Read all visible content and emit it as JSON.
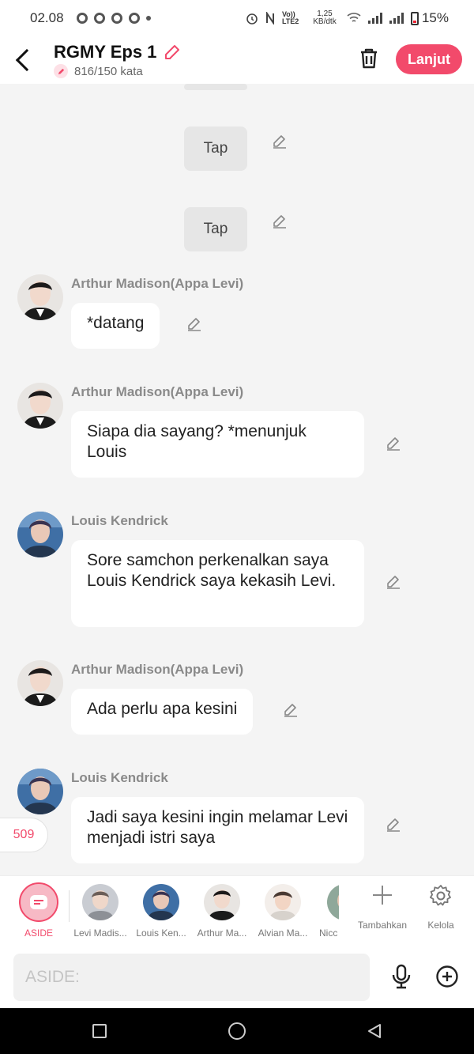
{
  "status_bar": {
    "time": "02.08",
    "net_label": "Vo)) LTE2",
    "speed": "1,25 KB/dtk",
    "battery": "15%"
  },
  "header": {
    "title": "RGMY Eps 1",
    "word_count": "816/150 kata",
    "next_button": "Lanjut"
  },
  "chat": {
    "tap_label": "Tap",
    "counter": "509",
    "messages": [
      {
        "sender": "Arthur Madison(Appa Levi)",
        "text": "*datang"
      },
      {
        "sender": "Arthur Madison(Appa Levi)",
        "text": "Siapa dia sayang? *menunjuk Louis"
      },
      {
        "sender": "Louis Kendrick",
        "text": "Sore samchon perkenalkan saya Louis Kendrick saya kekasih Levi."
      },
      {
        "sender": "Arthur Madison(Appa Levi)",
        "text": "Ada perlu apa kesini"
      },
      {
        "sender": "Louis Kendrick",
        "text": "Jadi saya kesini ingin melamar Levi menjadi istri saya"
      }
    ]
  },
  "character_bar": {
    "aside_label": "ASIDE",
    "characters": [
      "Levi Madis...",
      "Louis Ken...",
      "Arthur Ma...",
      "Alvian Ma...",
      "Nicc"
    ],
    "add_label": "Tambahkan",
    "manage_label": "Kelola"
  },
  "input": {
    "placeholder": "ASIDE:"
  },
  "colors": {
    "accent": "#f24a6b",
    "bubble": "#ffffff",
    "background": "#f4f4f4"
  }
}
